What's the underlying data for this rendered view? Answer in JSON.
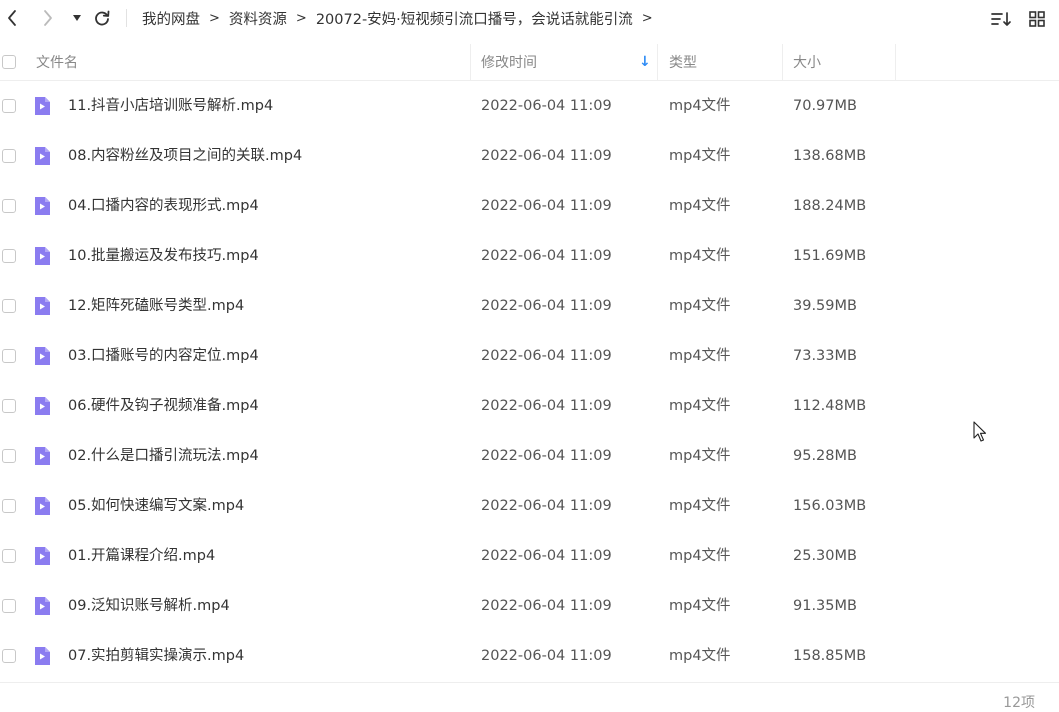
{
  "toolbar": {
    "back_icon": "chevron-left-icon",
    "forward_icon": "chevron-right-icon",
    "dropdown_icon": "caret-down-icon",
    "refresh_icon": "refresh-icon",
    "breadcrumb": [
      "我的网盘",
      "资料资源",
      "20072-安妈·短视频引流口播号，会说话就能引流"
    ],
    "separator": ">",
    "sort_icon": "sort-list-icon",
    "grid_icon": "grid-view-icon"
  },
  "columns": {
    "name": "文件名",
    "modified": "修改时间",
    "type": "类型",
    "size": "大小",
    "sort_indicator": "↓"
  },
  "files": [
    {
      "name": "11.抖音小店培训账号解析.mp4",
      "modified": "2022-06-04 11:09",
      "type": "mp4文件",
      "size": "70.97MB"
    },
    {
      "name": "08.内容粉丝及项目之间的关联.mp4",
      "modified": "2022-06-04 11:09",
      "type": "mp4文件",
      "size": "138.68MB"
    },
    {
      "name": "04.口播内容的表现形式.mp4",
      "modified": "2022-06-04 11:09",
      "type": "mp4文件",
      "size": "188.24MB"
    },
    {
      "name": "10.批量搬运及发布技巧.mp4",
      "modified": "2022-06-04 11:09",
      "type": "mp4文件",
      "size": "151.69MB"
    },
    {
      "name": "12.矩阵死磕账号类型.mp4",
      "modified": "2022-06-04 11:09",
      "type": "mp4文件",
      "size": "39.59MB"
    },
    {
      "name": "03.口播账号的内容定位.mp4",
      "modified": "2022-06-04 11:09",
      "type": "mp4文件",
      "size": "73.33MB"
    },
    {
      "name": "06.硬件及钩子视频准备.mp4",
      "modified": "2022-06-04 11:09",
      "type": "mp4文件",
      "size": "112.48MB"
    },
    {
      "name": "02.什么是口播引流玩法.mp4",
      "modified": "2022-06-04 11:09",
      "type": "mp4文件",
      "size": "95.28MB"
    },
    {
      "name": "05.如何快速编写文案.mp4",
      "modified": "2022-06-04 11:09",
      "type": "mp4文件",
      "size": "156.03MB"
    },
    {
      "name": "01.开篇课程介绍.mp4",
      "modified": "2022-06-04 11:09",
      "type": "mp4文件",
      "size": "25.30MB"
    },
    {
      "name": "09.泛知识账号解析.mp4",
      "modified": "2022-06-04 11:09",
      "type": "mp4文件",
      "size": "91.35MB"
    },
    {
      "name": "07.实拍剪辑实操演示.mp4",
      "modified": "2022-06-04 11:09",
      "type": "mp4文件",
      "size": "158.85MB"
    }
  ],
  "footer": {
    "count": "12项"
  },
  "colors": {
    "icon_purple": "#8b7cf0",
    "sort_arrow": "#2f8cf5",
    "text": "#333333",
    "muted": "#888888"
  }
}
